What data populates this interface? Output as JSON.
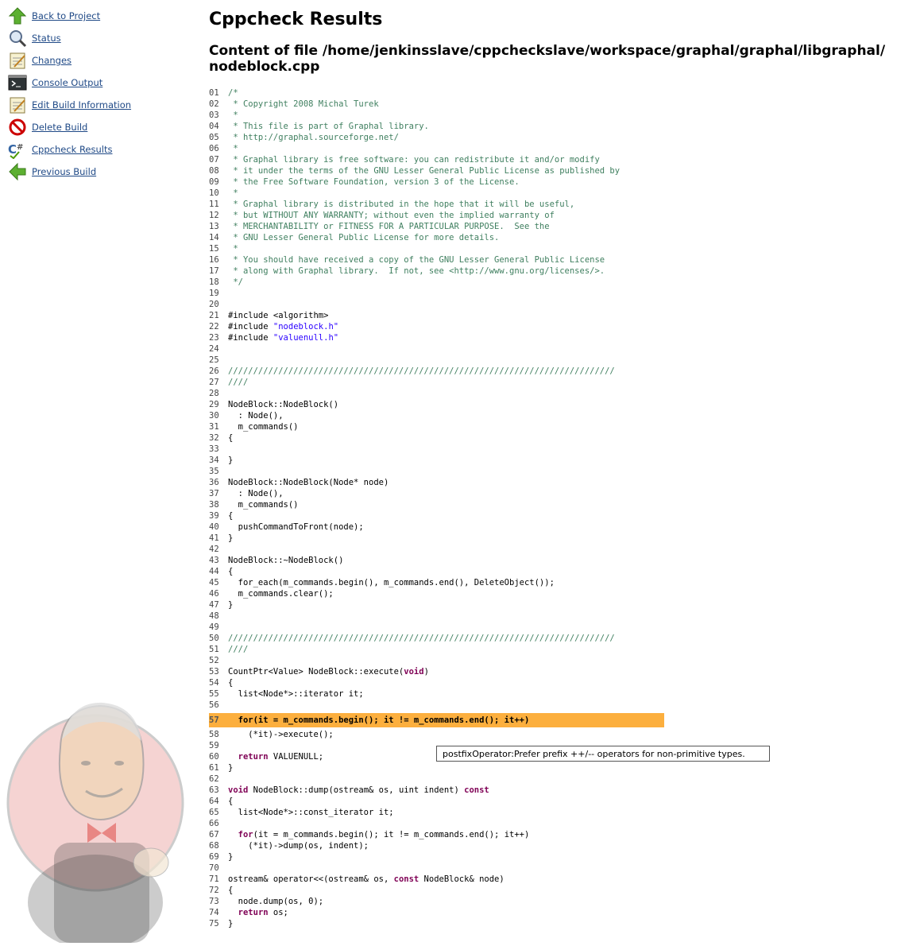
{
  "sidebar": {
    "items": [
      {
        "label": "Back to Project",
        "icon": "up-arrow-icon"
      },
      {
        "label": "Status",
        "icon": "search-icon"
      },
      {
        "label": "Changes",
        "icon": "notepad-icon"
      },
      {
        "label": "Console Output",
        "icon": "terminal-icon"
      },
      {
        "label": "Edit Build Information",
        "icon": "notepad-icon"
      },
      {
        "label": "Delete Build",
        "icon": "no-entry-icon"
      },
      {
        "label": "Cppcheck Results",
        "icon": "cppcheck-icon"
      },
      {
        "label": "Previous Build",
        "icon": "left-arrow-icon"
      }
    ]
  },
  "header": {
    "title": "Cppcheck Results",
    "subtitle": "Content of file /home/jenkinsslave/cppcheckslave/workspace/graphal/graphal/libgraphal/ nodeblock.cpp"
  },
  "code": {
    "highlight_line": "57",
    "lines": [
      {
        "n": "01",
        "t": "/*"
      },
      {
        "n": "02",
        "t": " * Copyright 2008 Michal Turek"
      },
      {
        "n": "03",
        "t": " *"
      },
      {
        "n": "04",
        "t": " * This file is part of Graphal library."
      },
      {
        "n": "05",
        "t": " * http://graphal.sourceforge.net/"
      },
      {
        "n": "06",
        "t": " *"
      },
      {
        "n": "07",
        "t": " * Graphal library is free software: you can redistribute it and/or modify"
      },
      {
        "n": "08",
        "t": " * it under the terms of the GNU Lesser General Public License as published by"
      },
      {
        "n": "09",
        "t": " * the Free Software Foundation, version 3 of the License."
      },
      {
        "n": "10",
        "t": " *"
      },
      {
        "n": "11",
        "t": " * Graphal library is distributed in the hope that it will be useful,"
      },
      {
        "n": "12",
        "t": " * but WITHOUT ANY WARRANTY; without even the implied warranty of"
      },
      {
        "n": "13",
        "t": " * MERCHANTABILITY or FITNESS FOR A PARTICULAR PURPOSE.  See the"
      },
      {
        "n": "14",
        "t": " * GNU Lesser General Public License for more details."
      },
      {
        "n": "15",
        "t": " *"
      },
      {
        "n": "16",
        "t": " * You should have received a copy of the GNU Lesser General Public License"
      },
      {
        "n": "17",
        "t": " * along with Graphal library.  If not, see <http://www.gnu.org/licenses/>."
      },
      {
        "n": "18",
        "t": " */"
      },
      {
        "n": "19",
        "t": ""
      },
      {
        "n": "20",
        "t": ""
      },
      {
        "n": "21",
        "t": "#include <algorithm>"
      },
      {
        "n": "22",
        "t": "#include \"nodeblock.h\""
      },
      {
        "n": "23",
        "t": "#include \"valuenull.h\""
      },
      {
        "n": "24",
        "t": ""
      },
      {
        "n": "25",
        "t": ""
      },
      {
        "n": "26",
        "t": "/////////////////////////////////////////////////////////////////////////////"
      },
      {
        "n": "27",
        "t": "////"
      },
      {
        "n": "28",
        "t": ""
      },
      {
        "n": "29",
        "t": "NodeBlock::NodeBlock()"
      },
      {
        "n": "30",
        "t": "  : Node(),"
      },
      {
        "n": "31",
        "t": "  m_commands()"
      },
      {
        "n": "32",
        "t": "{"
      },
      {
        "n": "33",
        "t": ""
      },
      {
        "n": "34",
        "t": "}"
      },
      {
        "n": "35",
        "t": ""
      },
      {
        "n": "36",
        "t": "NodeBlock::NodeBlock(Node* node)"
      },
      {
        "n": "37",
        "t": "  : Node(),"
      },
      {
        "n": "38",
        "t": "  m_commands()"
      },
      {
        "n": "39",
        "t": "{"
      },
      {
        "n": "40",
        "t": "  pushCommandToFront(node);"
      },
      {
        "n": "41",
        "t": "}"
      },
      {
        "n": "42",
        "t": ""
      },
      {
        "n": "43",
        "t": "NodeBlock::~NodeBlock()"
      },
      {
        "n": "44",
        "t": "{"
      },
      {
        "n": "45",
        "t": "  for_each(m_commands.begin(), m_commands.end(), DeleteObject());"
      },
      {
        "n": "46",
        "t": "  m_commands.clear();"
      },
      {
        "n": "47",
        "t": "}"
      },
      {
        "n": "48",
        "t": ""
      },
      {
        "n": "49",
        "t": ""
      },
      {
        "n": "50",
        "t": "/////////////////////////////////////////////////////////////////////////////"
      },
      {
        "n": "51",
        "t": "////"
      },
      {
        "n": "52",
        "t": ""
      },
      {
        "n": "53",
        "t": "CountPtr<Value> NodeBlock::execute(void)"
      },
      {
        "n": "54",
        "t": "{"
      },
      {
        "n": "55",
        "t": "  list<Node*>::iterator it;"
      },
      {
        "n": "56",
        "t": ""
      },
      {
        "n": "57",
        "t": "  for(it = m_commands.begin(); it != m_commands.end(); it++)"
      },
      {
        "n": "58",
        "t": "    (*it)->execute();"
      },
      {
        "n": "59",
        "t": ""
      },
      {
        "n": "60",
        "t": "  return VALUENULL;"
      },
      {
        "n": "61",
        "t": "}"
      },
      {
        "n": "62",
        "t": ""
      },
      {
        "n": "63",
        "t": "void NodeBlock::dump(ostream& os, uint indent) const"
      },
      {
        "n": "64",
        "t": "{"
      },
      {
        "n": "65",
        "t": "  list<Node*>::const_iterator it;"
      },
      {
        "n": "66",
        "t": ""
      },
      {
        "n": "67",
        "t": "  for(it = m_commands.begin(); it != m_commands.end(); it++)"
      },
      {
        "n": "68",
        "t": "    (*it)->dump(os, indent);"
      },
      {
        "n": "69",
        "t": "}"
      },
      {
        "n": "70",
        "t": ""
      },
      {
        "n": "71",
        "t": "ostream& operator<<(ostream& os, const NodeBlock& node)"
      },
      {
        "n": "72",
        "t": "{"
      },
      {
        "n": "73",
        "t": "  node.dump(os, 0);"
      },
      {
        "n": "74",
        "t": "  return os;"
      },
      {
        "n": "75",
        "t": "}"
      }
    ]
  },
  "tooltip": {
    "text": "postfixOperator:Prefer prefix ++/-- operators for non-primitive types."
  },
  "colors": {
    "link": "#204a87",
    "highlight": "#fcaf3e",
    "comment": "#3f7f5f",
    "string": "#2a00ff",
    "keyword": "#7f0055"
  }
}
